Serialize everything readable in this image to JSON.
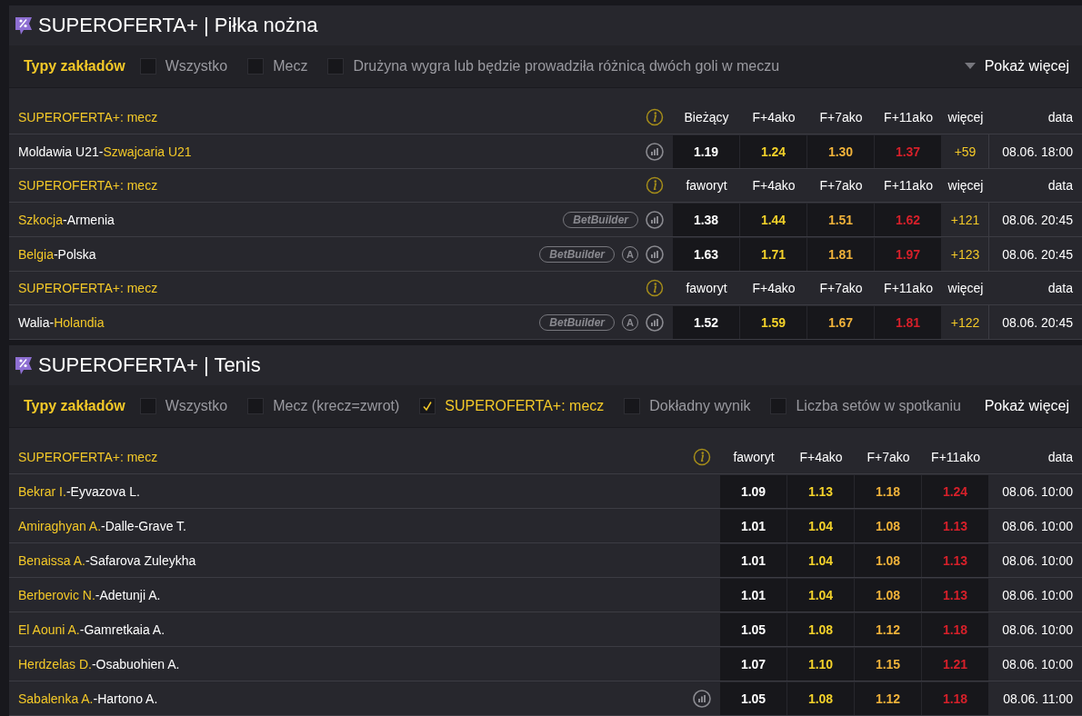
{
  "sections": [
    {
      "title": "SUPEROFERTA+ | Piłka nożna",
      "filter_label": "Typy zakładów",
      "show_more": {
        "label": "Pokaż więcej",
        "caret": true
      },
      "filters": [
        {
          "label": "Wszystko",
          "checked": false
        },
        {
          "label": "Mecz",
          "checked": false
        },
        {
          "label": "Drużyna wygra lub będzie prowadziła różnicą dwóch goli w meczu",
          "checked": false
        }
      ],
      "groups": [
        {
          "label": "SUPEROFERTA+: mecz",
          "columns": [
            "Bieżący",
            "F+4ako",
            "F+7ako",
            "F+11ako",
            "więcej",
            "data"
          ],
          "matches": [
            {
              "home": {
                "name": "Moldawia U21",
                "highlighted": false
              },
              "separator": "-",
              "away": {
                "name": "Szwajcaria U21",
                "highlighted": true
              },
              "stats": true,
              "odds": [
                "1.19",
                "1.24",
                "1.30",
                "1.37"
              ],
              "more": "+59",
              "date": "08.06. 18:00"
            }
          ]
        },
        {
          "label": "SUPEROFERTA+: mecz",
          "columns": [
            "faworyt",
            "F+4ako",
            "F+7ako",
            "F+11ako",
            "więcej",
            "data"
          ],
          "matches": [
            {
              "home": {
                "name": "Szkocja",
                "highlighted": true
              },
              "separator": "-",
              "away": {
                "name": "Armenia",
                "highlighted": false
              },
              "betbuilder": "BetBuilder",
              "stats": true,
              "odds": [
                "1.38",
                "1.44",
                "1.51",
                "1.62"
              ],
              "more": "+121",
              "date": "08.06. 20:45"
            },
            {
              "home": {
                "name": "Belgia",
                "highlighted": true
              },
              "separator": "-",
              "away": {
                "name": "Polska",
                "highlighted": false
              },
              "betbuilder": "BetBuilder",
              "badge": "A",
              "stats": true,
              "odds": [
                "1.63",
                "1.71",
                "1.81",
                "1.97"
              ],
              "more": "+123",
              "date": "08.06. 20:45"
            }
          ]
        },
        {
          "label": "SUPEROFERTA+: mecz",
          "columns": [
            "faworyt",
            "F+4ako",
            "F+7ako",
            "F+11ako",
            "więcej",
            "data"
          ],
          "matches": [
            {
              "home": {
                "name": "Walia",
                "highlighted": false
              },
              "separator": "-",
              "away": {
                "name": "Holandia",
                "highlighted": true
              },
              "betbuilder": "BetBuilder",
              "badge": "A",
              "stats": true,
              "odds": [
                "1.52",
                "1.59",
                "1.67",
                "1.81"
              ],
              "more": "+122",
              "date": "08.06. 20:45"
            }
          ]
        }
      ]
    },
    {
      "title": "SUPEROFERTA+ | Tenis",
      "filter_label": "Typy zakładów",
      "show_more": {
        "label": "Pokaż więcej",
        "caret": false
      },
      "filters": [
        {
          "label": "Wszystko",
          "checked": false
        },
        {
          "label": "Mecz (krecz=zwrot)",
          "checked": false
        },
        {
          "label": "SUPEROFERTA+: mecz",
          "checked": true
        },
        {
          "label": "Dokładny wynik",
          "checked": false
        },
        {
          "label": "Liczba setów w spotkaniu",
          "checked": false
        }
      ],
      "groups": [
        {
          "label": "SUPEROFERTA+: mecz",
          "columns": [
            "faworyt",
            "F+4ako",
            "F+7ako",
            "F+11ako",
            "data"
          ],
          "matches": [
            {
              "home": {
                "name": "Bekrar I.",
                "highlighted": true
              },
              "separator": "-",
              "away": {
                "name": "Eyvazova L.",
                "highlighted": false
              },
              "stats": false,
              "odds": [
                "1.09",
                "1.13",
                "1.18",
                "1.24"
              ],
              "date": "08.06. 10:00"
            },
            {
              "home": {
                "name": "Amiraghyan A.",
                "highlighted": true
              },
              "separator": "-",
              "away": {
                "name": "Dalle-Grave T.",
                "highlighted": false
              },
              "stats": false,
              "odds": [
                "1.01",
                "1.04",
                "1.08",
                "1.13"
              ],
              "date": "08.06. 10:00"
            },
            {
              "home": {
                "name": "Benaissa A.",
                "highlighted": true
              },
              "separator": "-",
              "away": {
                "name": "Safarova Zuleykha",
                "highlighted": false
              },
              "stats": false,
              "odds": [
                "1.01",
                "1.04",
                "1.08",
                "1.13"
              ],
              "date": "08.06. 10:00"
            },
            {
              "home": {
                "name": "Berberovic N.",
                "highlighted": true
              },
              "separator": "-",
              "away": {
                "name": "Adetunji A.",
                "highlighted": false
              },
              "stats": false,
              "odds": [
                "1.01",
                "1.04",
                "1.08",
                "1.13"
              ],
              "date": "08.06. 10:00"
            },
            {
              "home": {
                "name": "El Aouni A.",
                "highlighted": true
              },
              "separator": "-",
              "away": {
                "name": "Gamretkaia A.",
                "highlighted": false
              },
              "stats": false,
              "odds": [
                "1.05",
                "1.08",
                "1.12",
                "1.18"
              ],
              "date": "08.06. 10:00"
            },
            {
              "home": {
                "name": "Herdzelas D.",
                "highlighted": true
              },
              "separator": "-",
              "away": {
                "name": "Osabuohien A.",
                "highlighted": false
              },
              "stats": false,
              "odds": [
                "1.07",
                "1.10",
                "1.15",
                "1.21"
              ],
              "date": "08.06. 10:00"
            },
            {
              "home": {
                "name": "Sabalenka A.",
                "highlighted": true
              },
              "separator": "-",
              "away": {
                "name": "Hartono A.",
                "highlighted": false
              },
              "stats": true,
              "odds": [
                "1.05",
                "1.08",
                "1.12",
                "1.18"
              ],
              "date": "08.06. 11:00"
            }
          ]
        }
      ]
    }
  ]
}
